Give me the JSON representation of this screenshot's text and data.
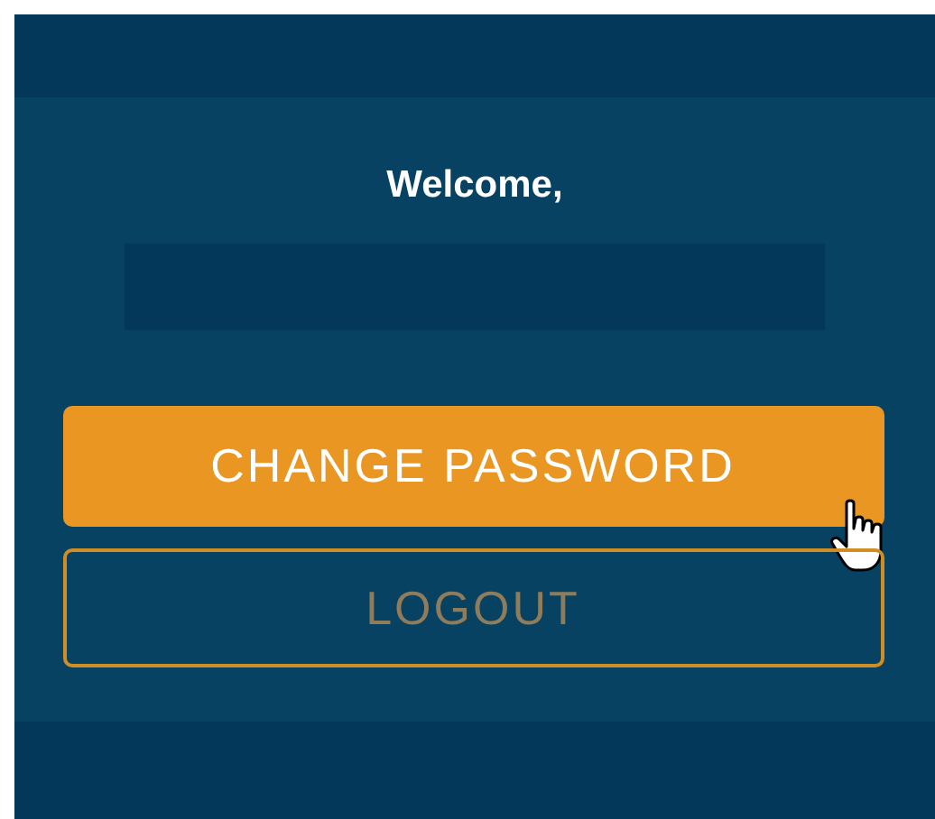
{
  "greeting": "Welcome,",
  "buttons": [
    {
      "label": "CHANGE PASSWORD",
      "kind": "primary",
      "hovered": true
    },
    {
      "label": "LOGOUT",
      "kind": "outline",
      "hovered": false
    }
  ]
}
